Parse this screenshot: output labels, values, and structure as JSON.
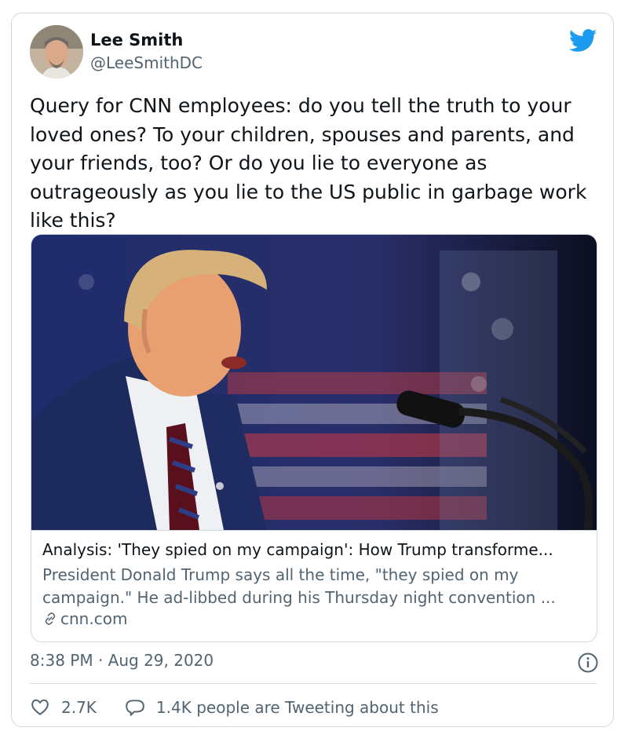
{
  "author": {
    "name": "Lee Smith",
    "handle": "@LeeSmithDC"
  },
  "tweet": {
    "text": "Query for CNN employees: do you tell the truth to your loved ones? To your children, spouses and parents, and your friends, too? Or do you lie to everyone as outrageously as you lie to the US public in garbage work like this?",
    "timestamp": "8:38 PM · Aug 29, 2020"
  },
  "link_card": {
    "title": "Analysis: 'They spied on my campaign': How Trump transforme...",
    "description": "President Donald Trump says all the time, \"they spied on my campaign.\" He ad-libbed during his Thursday night convention ...",
    "domain": "cnn.com"
  },
  "stats": {
    "likes": "2.7K",
    "conversation": "1.4K people are Tweeting about this"
  },
  "icons": {
    "brand": "twitter-bird-icon",
    "info": "info-icon",
    "like": "heart-icon",
    "reply": "speech-bubble-icon",
    "link": "link-icon"
  },
  "colors": {
    "brand": "#1d9bf0",
    "muted": "#536471",
    "border": "#cfd9de"
  }
}
